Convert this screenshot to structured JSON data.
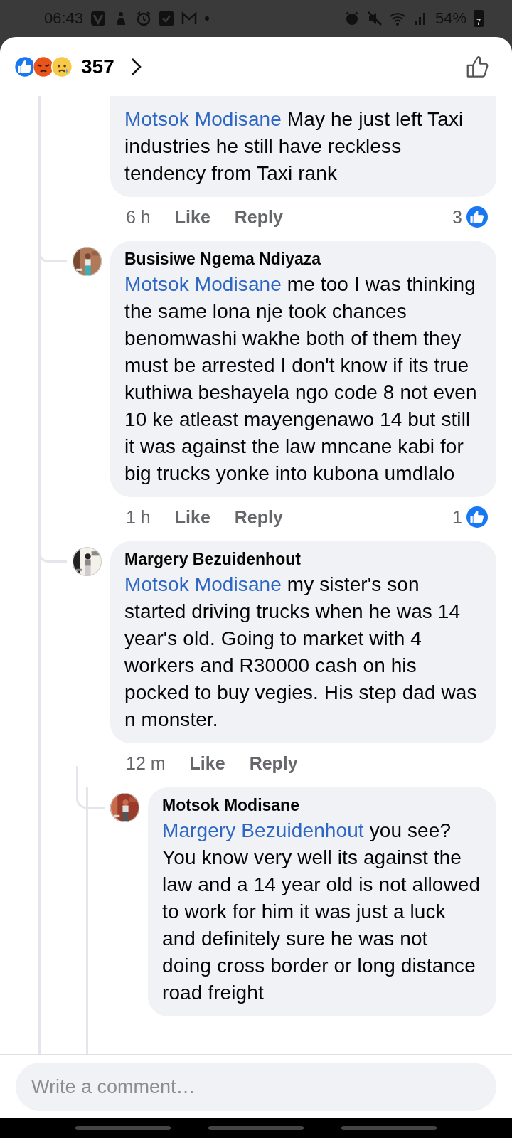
{
  "status_bar": {
    "time": "06:43",
    "battery": "54%",
    "battery_badge": "7"
  },
  "header": {
    "reaction_count": "357"
  },
  "comments": [
    {
      "mention": "Motsok Modisane",
      "text": "May he just left Taxi industries he still have reckless tendency from Taxi rank",
      "time": "6 h",
      "like": "Like",
      "reply": "Reply",
      "reactions": "3"
    },
    {
      "author": "Busisiwe Ngema Ndiyaza",
      "mention": "Motsok Modisane",
      "text": "me too I was thinking the same lona  nje took chances benomwashi wakhe both of them they must be arrested I don't know if its true kuthiwa beshayela ngo code 8 not even 10 ke atleast mayengenawo 14 but still it was against the law mncane kabi for big trucks yonke into kubona umdlalo",
      "time": "1 h",
      "like": "Like",
      "reply": "Reply",
      "reactions": "1"
    },
    {
      "author": "Margery Bezuidenhout",
      "mention": "Motsok Modisane",
      "text": "my sister's son started driving trucks when he was 14 year's old. Going to market with 4 workers and R30000 cash on his pocked to buy vegies. His step dad was n monster.",
      "time": "12 m",
      "like": "Like",
      "reply": "Reply",
      "children": [
        {
          "author": "Motsok Modisane",
          "mention": "Margery Bezuidenhout",
          "text": "you see? You know very well its against the law and a 14 year old is not allowed to work for him it was just a luck and definitely sure he was not doing cross border or long distance road freight"
        }
      ]
    }
  ],
  "composer": {
    "placeholder": "Write a comment…"
  }
}
